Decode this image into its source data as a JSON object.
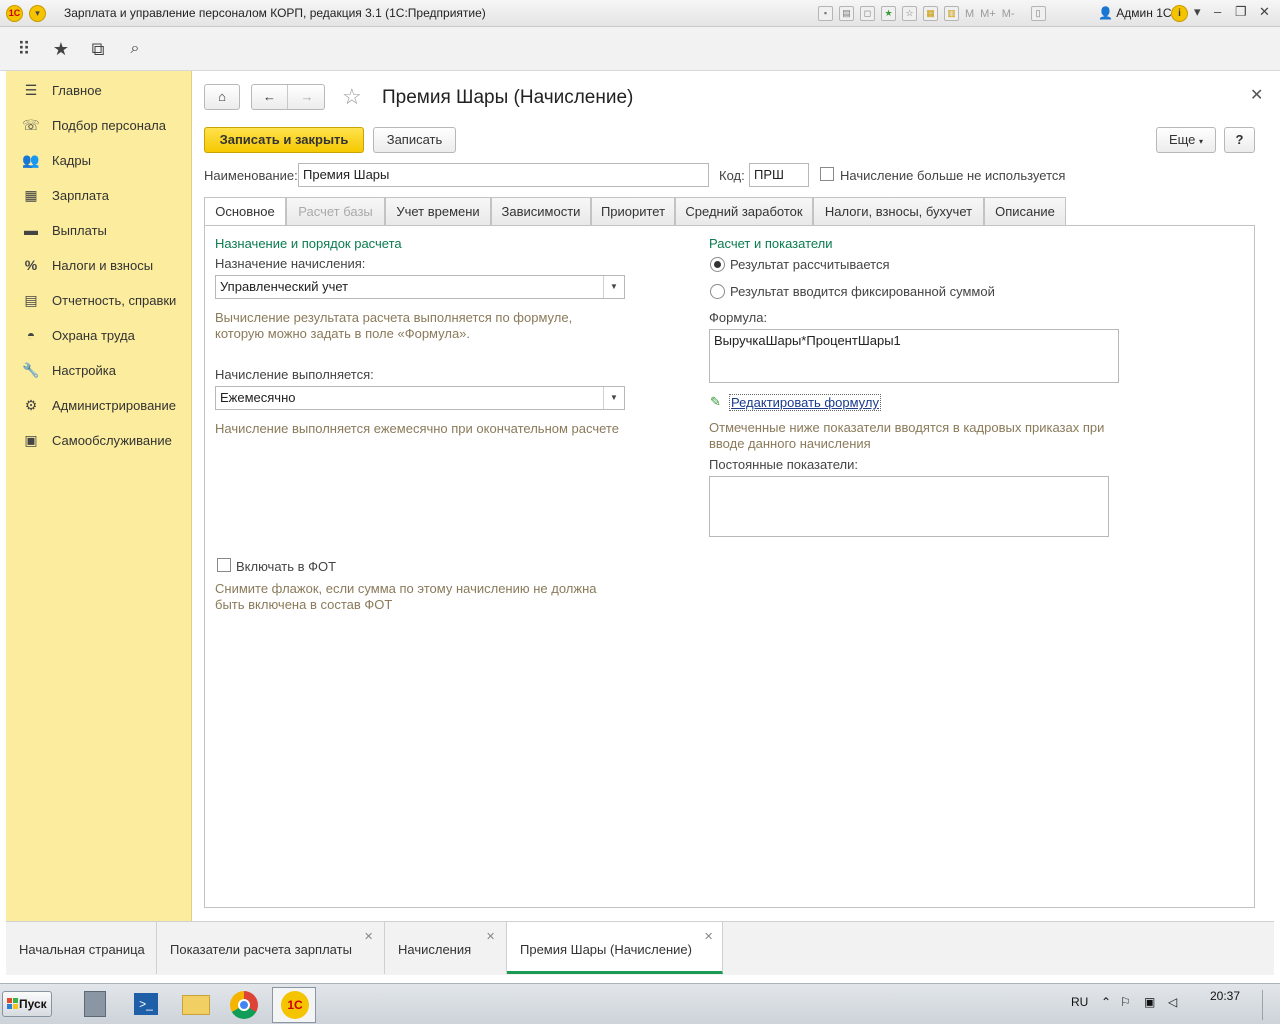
{
  "window": {
    "title": "Зарплата и управление персоналом КОРП, редакция 3.1  (1С:Предприятие)",
    "user": "Админ 1С",
    "m_buttons": [
      "M",
      "M+",
      "M-"
    ]
  },
  "sidebar": {
    "items": [
      {
        "label": "Главное",
        "icon": "menu-icon"
      },
      {
        "label": "Подбор персонала",
        "icon": "phone-icon"
      },
      {
        "label": "Кадры",
        "icon": "people-icon"
      },
      {
        "label": "Зарплата",
        "icon": "calculator-icon"
      },
      {
        "label": "Выплаты",
        "icon": "card-icon"
      },
      {
        "label": "Налоги и взносы",
        "icon": "percent-icon"
      },
      {
        "label": "Отчетность, справки",
        "icon": "report-icon"
      },
      {
        "label": "Охрана труда",
        "icon": "helmet-icon"
      },
      {
        "label": "Настройка",
        "icon": "wrench-icon"
      },
      {
        "label": "Администрирование",
        "icon": "gear-icon"
      },
      {
        "label": "Самообслуживание",
        "icon": "id-card-icon"
      }
    ]
  },
  "form": {
    "title": "Премия Шары (Начисление)",
    "save_close": "Записать и закрыть",
    "save": "Записать",
    "more": "Еще",
    "help": "?",
    "name_label": "Наименование:",
    "name_value": "Премия Шары",
    "code_label": "Код:",
    "code_value": "ПРШ",
    "not_used_label": "Начисление больше не используется"
  },
  "tabs": [
    {
      "label": "Основное"
    },
    {
      "label": "Расчет базы"
    },
    {
      "label": "Учет времени"
    },
    {
      "label": "Зависимости"
    },
    {
      "label": "Приоритет"
    },
    {
      "label": "Средний заработок"
    },
    {
      "label": "Налоги, взносы, бухучет"
    },
    {
      "label": "Описание"
    }
  ],
  "left": {
    "group_title": "Назначение и порядок расчета",
    "purpose_label": "Назначение начисления:",
    "purpose_value": "Управленческий учет",
    "purpose_hint_1": "Вычисление результата расчета выполняется по формуле,",
    "purpose_hint_2": "которую можно задать в поле «Формула».",
    "period_label": "Начисление выполняется:",
    "period_value": "Ежемесячно",
    "period_hint": "Начисление выполняется ежемесячно при окончательном расчете",
    "fot_label": "Включать в ФОТ",
    "fot_hint_1": "Снимите флажок, если сумма по этому начислению не должна",
    "fot_hint_2": "быть включена в состав ФОТ"
  },
  "right": {
    "group_title": "Расчет и показатели",
    "radio_calc": "Результат рассчитывается",
    "radio_fixed": "Результат вводится фиксированной суммой",
    "formula_label": "Формула:",
    "formula_value": "ВыручкаШары*ПроцентШары1",
    "edit_formula": "Редактировать формулу",
    "indicators_hint_1": "Отмеченные ниже показатели вводятся в кадровых приказах при",
    "indicators_hint_2": "вводе данного начисления",
    "const_label": "Постоянные показатели:"
  },
  "open_tabs": [
    {
      "label": "Начальная страница"
    },
    {
      "label": "Показатели расчета зарплаты"
    },
    {
      "label": "Начисления"
    },
    {
      "label": "Премия Шары (Начисление)"
    }
  ],
  "taskbar": {
    "start": "Пуск",
    "lang": "RU",
    "time": "20:37"
  },
  "colors": {
    "sidebar_bg": "#fbec9e",
    "accent_yellow": "#f5c800",
    "group_green": "#0a7c4e",
    "active_tab_underline": "#1a9a53"
  }
}
